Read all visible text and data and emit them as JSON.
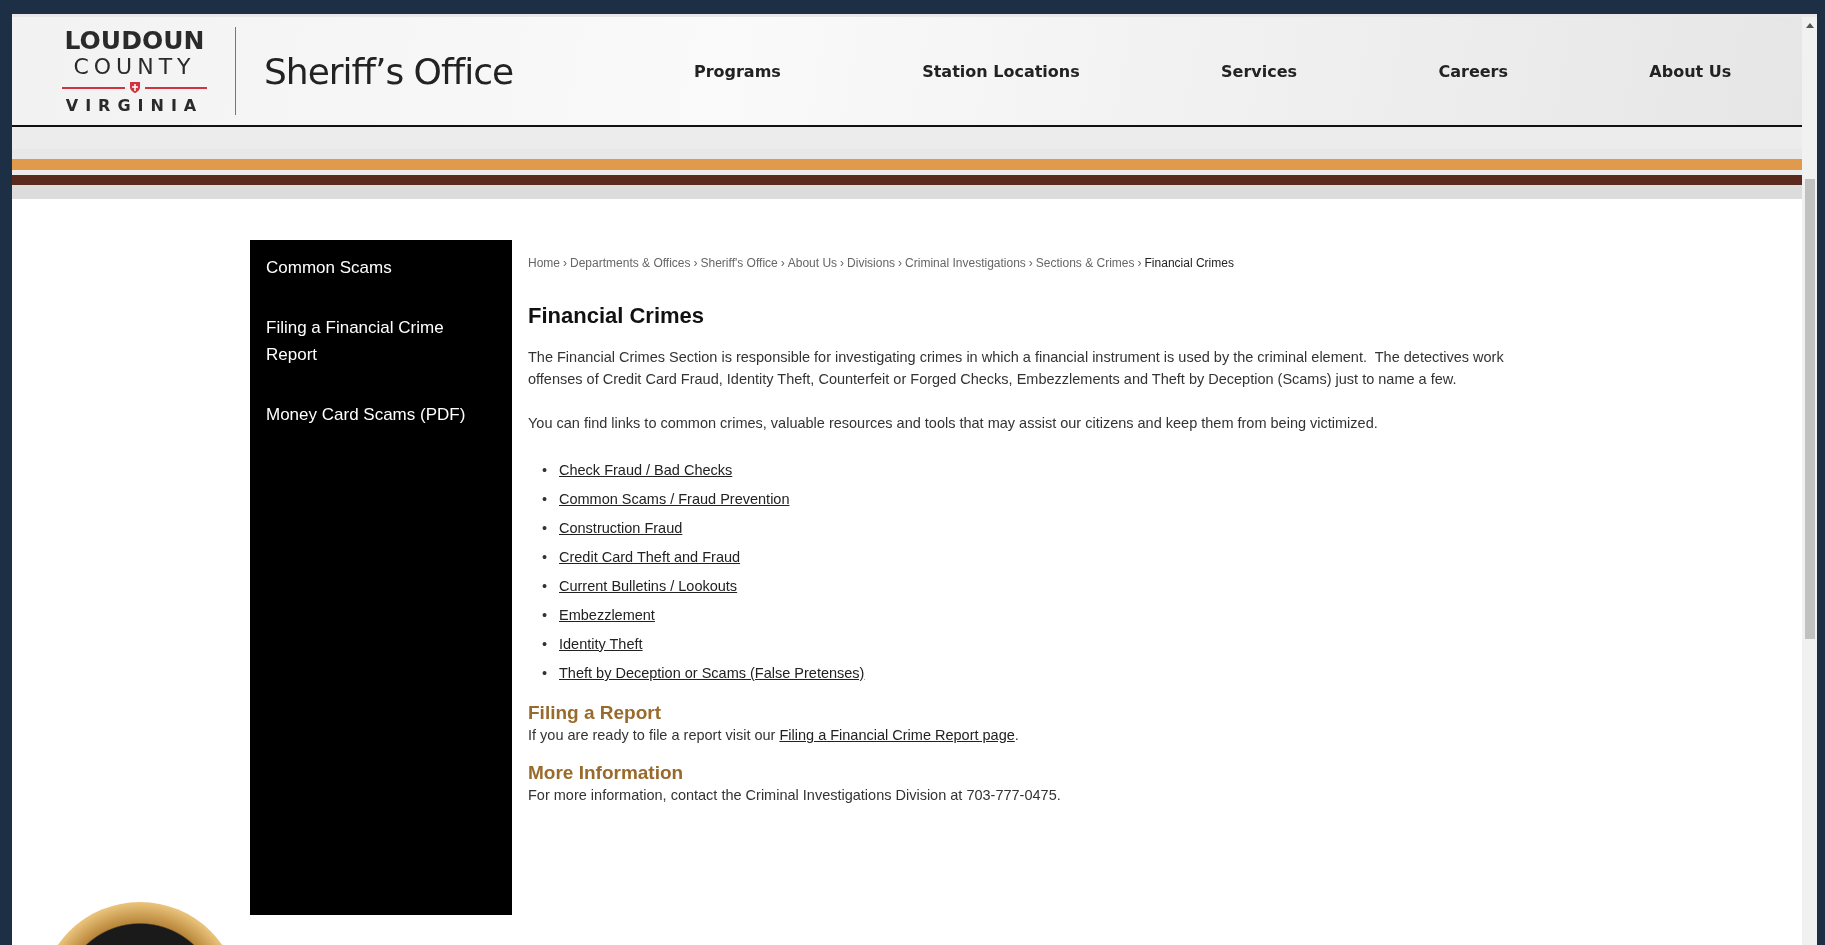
{
  "header": {
    "logo": {
      "line_1": "LOUDOUN",
      "line_2": "COUNTY",
      "line_3": "VIRGINIA"
    },
    "site_title": "Sheriff’s Office",
    "nav": [
      {
        "label": "Programs"
      },
      {
        "label": "Station Locations"
      },
      {
        "label": "Services"
      },
      {
        "label": "Careers"
      },
      {
        "label": "About Us"
      }
    ]
  },
  "sidebar": {
    "items": [
      {
        "label": "Common Scams"
      },
      {
        "label": "Filing a Financial Crime Report"
      },
      {
        "label": "Money Card Scams (PDF)"
      }
    ]
  },
  "breadcrumb": {
    "links": [
      {
        "label": "Home",
        "separator": "›"
      },
      {
        "label": "Departments & Offices",
        "separator": "›"
      },
      {
        "label": "Sheriff's Office",
        "separator": "›"
      },
      {
        "label": "About Us",
        "separator": "›"
      },
      {
        "label": "Divisions",
        "separator": "›"
      },
      {
        "label": "Criminal Investigations",
        "separator": "›"
      },
      {
        "label": "Sections & Crimes",
        "separator": "›"
      }
    ],
    "current": "Financial Crimes"
  },
  "content": {
    "title": "Financial Crimes",
    "paragraphs": [
      "The Financial Crimes Section is responsible for investigating crimes in which a financial instrument is used by the criminal element.  The detectives work offenses of Credit Card Fraud, Identity Theft, Counterfeit or Forged Checks, Embezzlements and Theft by Deception (Scams) just to name a few.",
      "You can find links to common crimes, valuable resources and tools that may assist our citizens and keep them from being victimized."
    ],
    "links": [
      {
        "bullet": "•",
        "label": "Check Fraud / Bad Checks"
      },
      {
        "bullet": "•",
        "label": "Common Scams / Fraud Prevention"
      },
      {
        "bullet": "•",
        "label": "Construction Fraud"
      },
      {
        "bullet": "•",
        "label": "Credit Card Theft and Fraud"
      },
      {
        "bullet": "•",
        "label": "Current Bulletins / Lookouts"
      },
      {
        "bullet": "•",
        "label": "Embezzlement"
      },
      {
        "bullet": "•",
        "label": "Identity Theft"
      },
      {
        "bullet": "•",
        "label": "Theft by Deception or Scams (False Pretenses)"
      }
    ],
    "filing": {
      "heading": "Filing a Report",
      "text_before": "If you are ready to file a report visit our",
      "link": "Filing a Financial Crime Report page",
      "text_after": "."
    },
    "more_info": {
      "heading": "More Information",
      "text": "For more information, contact the Criminal Investigations Division at 703-777-0475."
    }
  }
}
